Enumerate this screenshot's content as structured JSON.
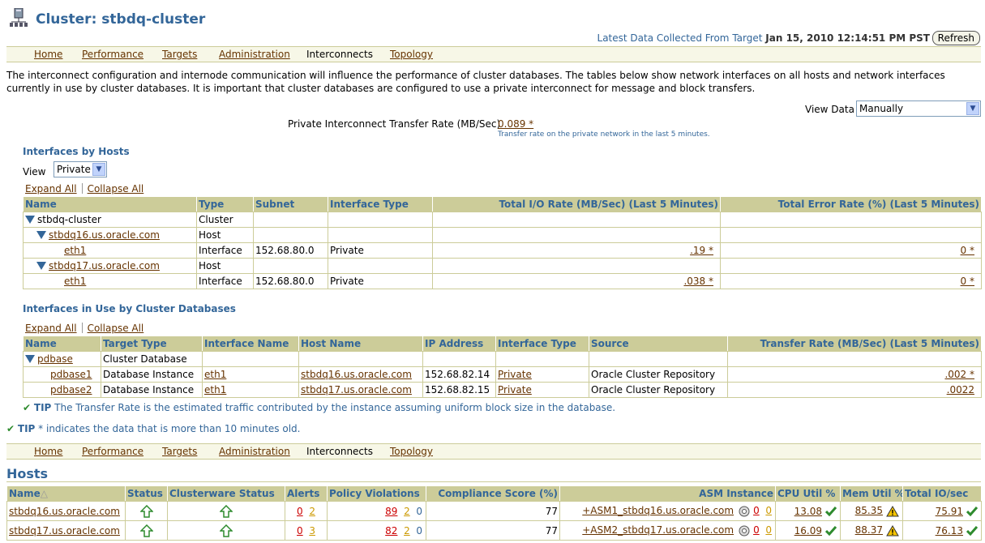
{
  "header": {
    "title": "Cluster: stbdq-cluster",
    "latest_label": "Latest Data Collected From Target",
    "latest_value": "Jan 15, 2010 12:14:51 PM PST",
    "refresh_label": "Refresh"
  },
  "tabs": [
    "Home",
    "Performance",
    "Targets",
    "Administration",
    "Interconnects",
    "Topology"
  ],
  "current_tab": "Interconnects",
  "intro": "The interconnect configuration and internode communication will influence the performance of cluster databases. The tables below show network interfaces on all hosts and network interfaces currently in use by cluster databases. It is important that cluster databases are configured to use a private interconnect for message and block transfers.",
  "view_data": {
    "label": "View Data",
    "value": "Manually"
  },
  "private_rate": {
    "label": "Private Interconnect Transfer Rate (MB/Sec)",
    "value": "0.089 *",
    "note": "Transfer rate on the private network in the last 5 minutes."
  },
  "interfaces_by_hosts": {
    "title": "Interfaces by Hosts",
    "view_label": "View",
    "view_value": "Private",
    "expand_all": "Expand All",
    "collapse_all": "Collapse All",
    "columns": [
      "Name",
      "Type",
      "Subnet",
      "Interface Type",
      "Total I/O Rate (MB/Sec) (Last 5 Minutes)",
      "Total Error Rate (%) (Last 5 Minutes)"
    ],
    "rows": [
      {
        "name": "stbdq-cluster",
        "type": "Cluster",
        "subnet": "",
        "itype": "",
        "io": "",
        "err": ""
      },
      {
        "name": "stbdq16.us.oracle.com",
        "type": "Host",
        "subnet": "",
        "itype": "",
        "io": "",
        "err": ""
      },
      {
        "name": "eth1",
        "type": "Interface",
        "subnet": "152.68.80.0",
        "itype": "Private",
        "io": ".19 *",
        "err": "0 *"
      },
      {
        "name": "stbdq17.us.oracle.com",
        "type": "Host",
        "subnet": "",
        "itype": "",
        "io": "",
        "err": ""
      },
      {
        "name": "eth1",
        "type": "Interface",
        "subnet": "152.68.80.0",
        "itype": "Private",
        "io": ".038 *",
        "err": "0 *"
      }
    ]
  },
  "interfaces_in_use": {
    "title": "Interfaces in Use by Cluster Databases",
    "expand_all": "Expand All",
    "collapse_all": "Collapse All",
    "columns": [
      "Name",
      "Target Type",
      "Interface Name",
      "Host Name",
      "IP Address",
      "Interface Type",
      "Source",
      "Transfer Rate (MB/Sec) (Last 5 Minutes)"
    ],
    "rows": [
      {
        "name": "pdbase",
        "ttype": "Cluster Database",
        "iname": "",
        "host": "",
        "ip": "",
        "itype": "",
        "source": "",
        "rate": ""
      },
      {
        "name": "pdbase1",
        "ttype": "Database Instance",
        "iname": "eth1",
        "host": "stbdq16.us.oracle.com",
        "ip": "152.68.82.14",
        "itype": "Private",
        "source": "Oracle Cluster Repository",
        "rate": ".002 *"
      },
      {
        "name": "pdbase2",
        "ttype": "Database Instance",
        "iname": "eth1",
        "host": "stbdq17.us.oracle.com",
        "ip": "152.68.82.15",
        "itype": "Private",
        "source": "Oracle Cluster Repository",
        "rate": ".0022"
      }
    ]
  },
  "tips": {
    "tip_label": "TIP",
    "tip1": "The Transfer Rate is the estimated traffic contributed by the instance assuming uniform block size in the database.",
    "tip2": "* indicates the data that is more than 10 minutes old."
  },
  "hosts": {
    "title": "Hosts",
    "columns": [
      "Name",
      "Status",
      "Clusterware Status",
      "Alerts",
      "Policy Violations",
      "Compliance Score (%)",
      "ASM Instance",
      "CPU Util %",
      "Mem Util %",
      "Total IO/sec"
    ],
    "rows": [
      {
        "name": "stbdq16.us.oracle.com",
        "alert_red": "0",
        "alert_org": "2",
        "pv_red": "89",
        "pv_org": "2",
        "pv_blu": "0",
        "compliance": "77",
        "asm": "+ASM1_stbdq16.us.oracle.com",
        "asm_a": "0",
        "asm_b": "0",
        "cpu": "13.08",
        "mem": "85.35",
        "io": "75.91"
      },
      {
        "name": "stbdq17.us.oracle.com",
        "alert_red": "0",
        "alert_org": "3",
        "pv_red": "82",
        "pv_org": "2",
        "pv_blu": "0",
        "compliance": "77",
        "asm": "+ASM2_stbdq17.us.oracle.com",
        "asm_a": "0",
        "asm_b": "0",
        "cpu": "16.09",
        "mem": "88.37",
        "io": "76.13"
      }
    ]
  },
  "colors": {
    "accent": "#336699",
    "header_bg": "#cccc99",
    "link": "#663300"
  }
}
